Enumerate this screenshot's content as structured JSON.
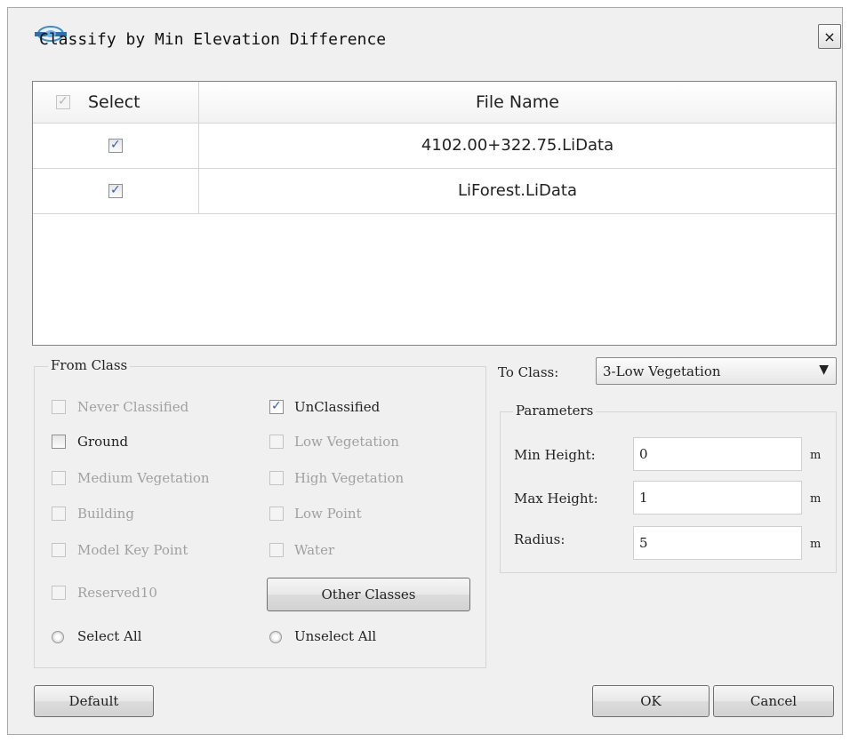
{
  "window": {
    "title": "Classify by Min Elevation Difference",
    "close_label": "×"
  },
  "table": {
    "headers": {
      "select": "Select",
      "file_name": "File Name"
    },
    "rows": [
      {
        "checked": true,
        "file_name": "4102.00+322.75.LiData"
      },
      {
        "checked": true,
        "file_name": "LiForest.LiData"
      }
    ]
  },
  "from_class": {
    "label": "From Class",
    "options": [
      {
        "label": "Never Classified",
        "checked": false,
        "enabled": false
      },
      {
        "label": "UnClassified",
        "checked": true,
        "enabled": true
      },
      {
        "label": "Ground",
        "checked": false,
        "enabled": true
      },
      {
        "label": "Low Vegetation",
        "checked": false,
        "enabled": false
      },
      {
        "label": "Medium Vegetation",
        "checked": false,
        "enabled": false
      },
      {
        "label": "High Vegetation",
        "checked": false,
        "enabled": false
      },
      {
        "label": "Building",
        "checked": false,
        "enabled": false
      },
      {
        "label": "Low Point",
        "checked": false,
        "enabled": false
      },
      {
        "label": "Model Key Point",
        "checked": false,
        "enabled": false
      },
      {
        "label": "Water",
        "checked": false,
        "enabled": false
      },
      {
        "label": "Reserved10",
        "checked": false,
        "enabled": false
      }
    ],
    "other_classes_label": "Other Classes",
    "select_all_label": "Select All",
    "unselect_all_label": "Unselect All"
  },
  "to_class": {
    "label": "To Class:",
    "value": "3-Low Vegetation",
    "arrow": "▼"
  },
  "parameters": {
    "label": "Parameters",
    "min_height": {
      "label": "Min Height:",
      "value": "0",
      "unit": "m"
    },
    "max_height": {
      "label": "Max Height:",
      "value": "1",
      "unit": "m"
    },
    "radius": {
      "label": "Radius:",
      "value": "5",
      "unit": "m"
    }
  },
  "buttons": {
    "default": "Default",
    "ok": "OK",
    "cancel": "Cancel"
  },
  "check_glyph": "✓",
  "colors": {
    "check_accent": "#3a5ea8",
    "disabled_text": "#a0a0a0"
  }
}
